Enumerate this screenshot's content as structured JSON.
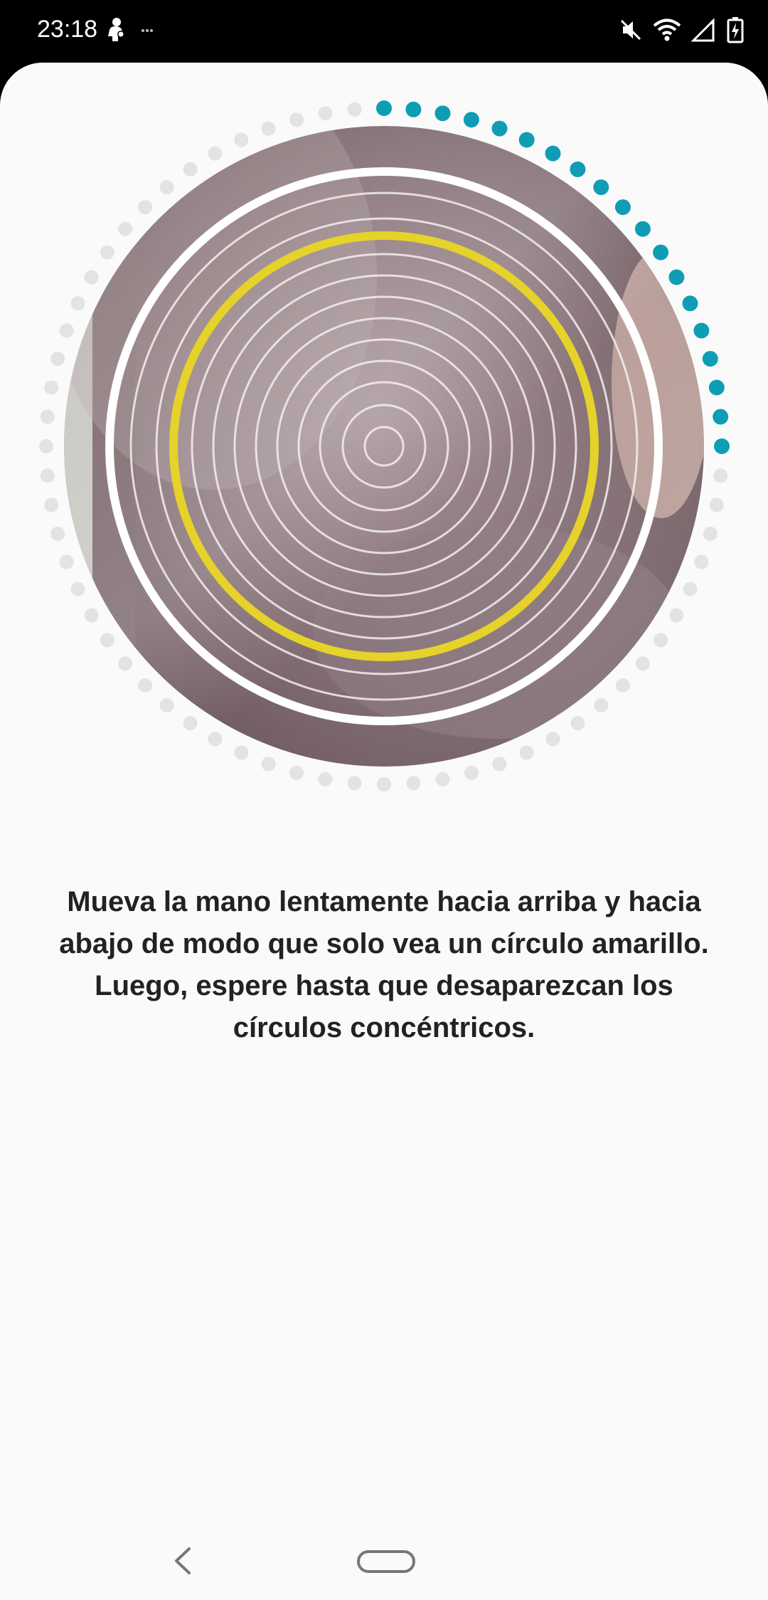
{
  "status_bar": {
    "time": "23:18",
    "left_icons": [
      "person-notification-icon",
      "more-notifications-icon"
    ],
    "right_icons": [
      "sound-muted-icon",
      "wifi-icon",
      "cell-signal-icon",
      "battery-charging-icon"
    ]
  },
  "scanner": {
    "progress_fraction": 0.25,
    "colors": {
      "progress_dots": "#0f9db5",
      "remaining_dots": "#e3e3e3",
      "target_ring": "#e5d22a",
      "frame_ring": "#ffffff"
    }
  },
  "instruction": {
    "line1": "Mueva la mano lentamente hacia arriba y hacia",
    "line2": "abajo de modo que solo vea un círculo amarillo.",
    "line3": "Luego, espere hasta que desaparezcan los",
    "line4": "círculos concéntricos."
  },
  "navigation": {
    "back_icon": "back-chevron-icon",
    "home_icon": "home-pill-icon"
  }
}
